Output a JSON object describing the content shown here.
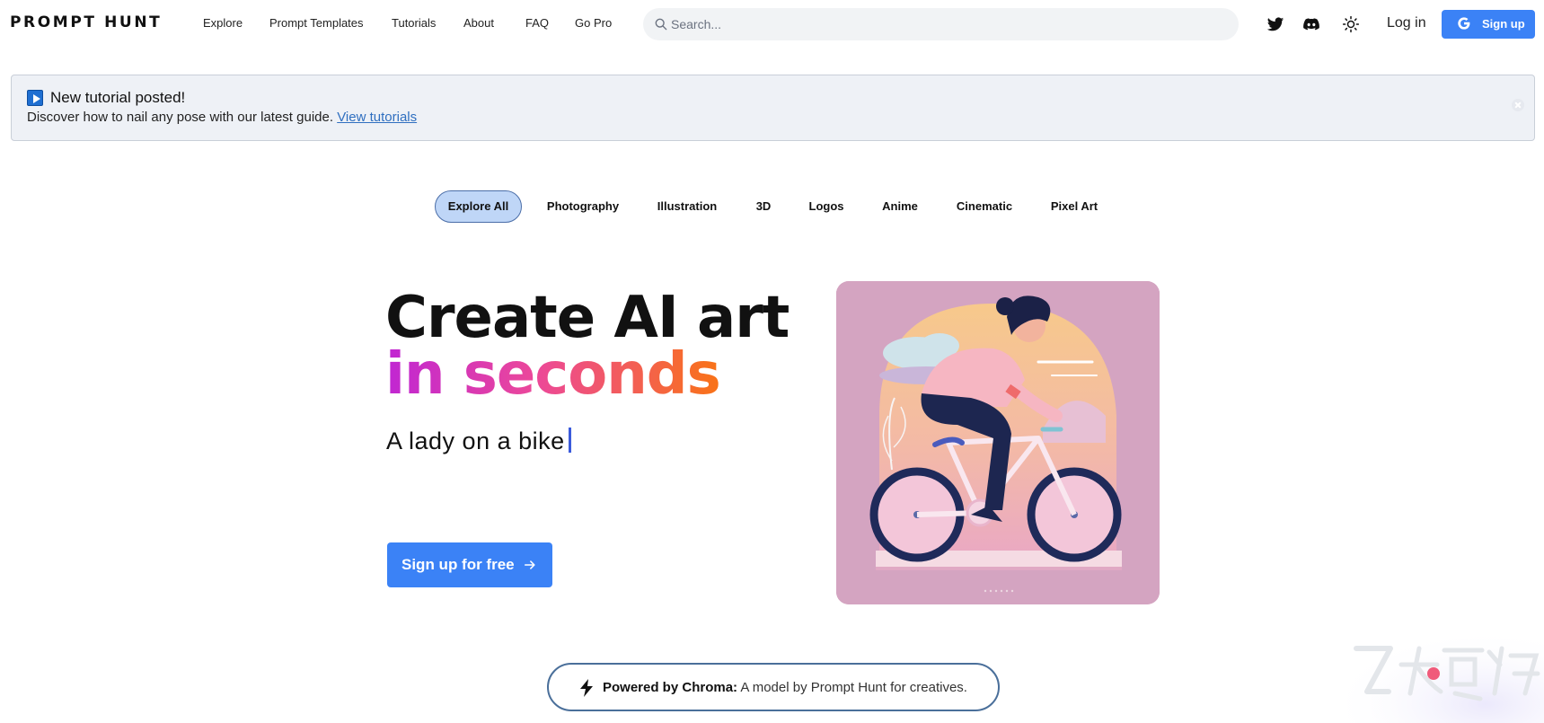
{
  "header": {
    "logo": "PROMPT HUNT",
    "nav": [
      "Explore",
      "Prompt Templates",
      "Tutorials",
      "About",
      "FAQ",
      "Go Pro"
    ],
    "search_placeholder": "Search...",
    "login_label": "Log in",
    "signup_label": "Sign up",
    "icons": [
      "twitter-icon",
      "discord-icon",
      "sun-icon",
      "google-icon"
    ]
  },
  "banner": {
    "title": "New tutorial posted!",
    "text": "Discover how to nail any pose with our latest guide.",
    "link": "View tutorials"
  },
  "categories": [
    {
      "label": "Explore All",
      "active": true
    },
    {
      "label": "Photography",
      "active": false
    },
    {
      "label": "Illustration",
      "active": false
    },
    {
      "label": "3D",
      "active": false
    },
    {
      "label": "Logos",
      "active": false
    },
    {
      "label": "Anime",
      "active": false
    },
    {
      "label": "Cinematic",
      "active": false
    },
    {
      "label": "Pixel Art",
      "active": false
    }
  ],
  "hero": {
    "line1": "Create AI art",
    "line2": "in seconds",
    "typed_prompt": "A lady on a bike",
    "cta_label": "Sign up for free",
    "image_subject": "illustration of a woman riding a pink bicycle"
  },
  "powered": {
    "bold": "Powered by Chroma:",
    "text": " A model by Prompt Hunt for creatives."
  },
  "watermark": {
    "text": "INTSHARING"
  },
  "colors": {
    "primary": "#3b82f6",
    "active_tab_bg": "#bfd6f7",
    "banner_bg": "#eef1f6",
    "gradient": [
      "#c026d3",
      "#ec4899",
      "#f97316"
    ]
  }
}
